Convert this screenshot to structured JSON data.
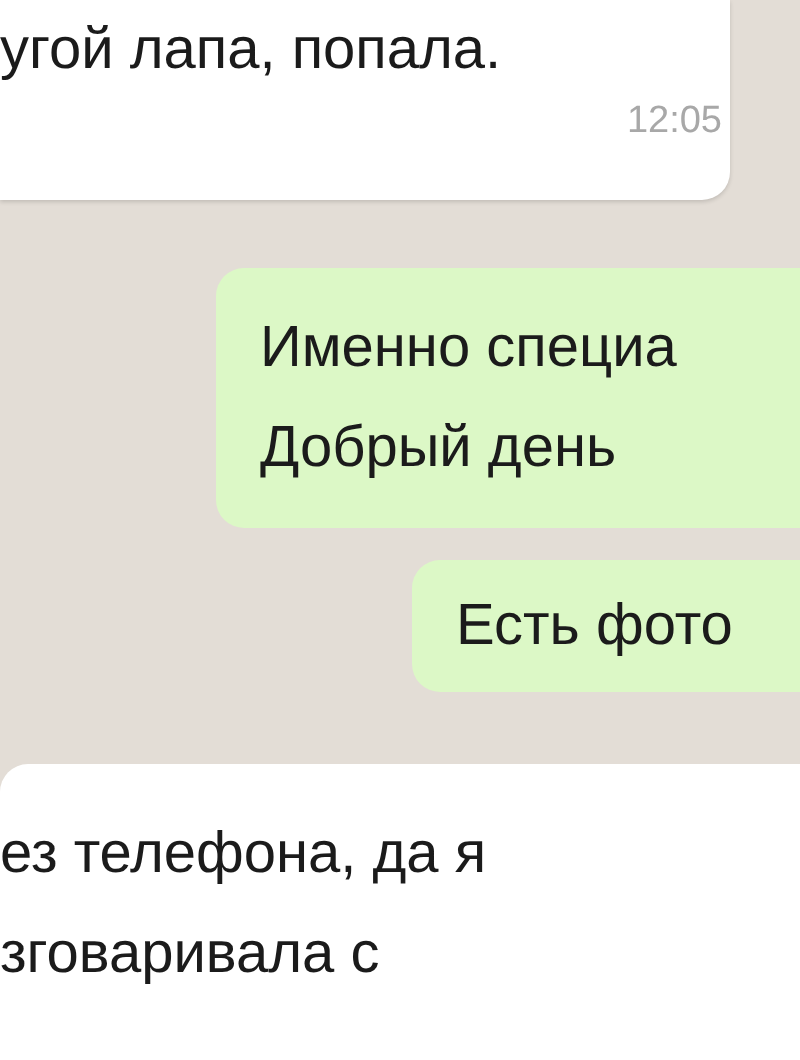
{
  "messages": [
    {
      "kind": "incoming",
      "lines": [
        "угой лапа, попала."
      ],
      "time": "12:05"
    },
    {
      "kind": "outgoing",
      "lines": [
        "Именно специа",
        "Добрый день"
      ]
    },
    {
      "kind": "outgoing",
      "lines": [
        "Есть фото"
      ]
    },
    {
      "kind": "incoming",
      "lines": [
        "ез телефона, да я",
        "зговаривала с"
      ]
    }
  ]
}
